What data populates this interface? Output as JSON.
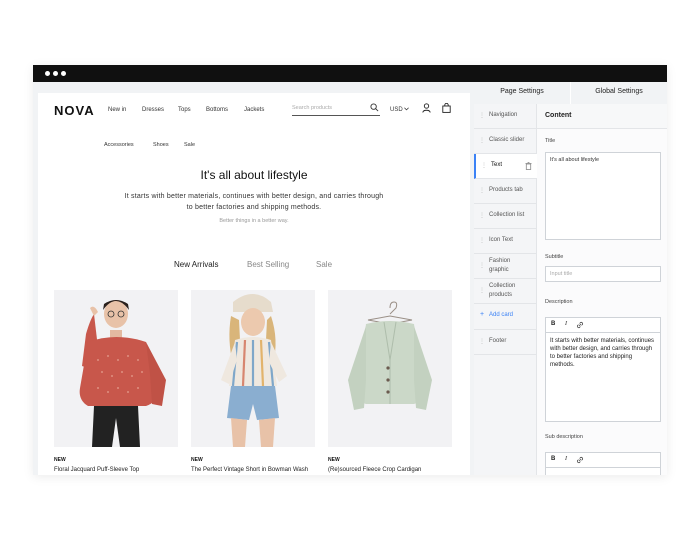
{
  "store": {
    "logo": "NOVA",
    "nav": [
      "New in",
      "Dresses",
      "Tops",
      "Bottoms",
      "Jackets"
    ],
    "search_placeholder": "Search products",
    "currency": "USD",
    "subnav": [
      "Accessories",
      "Shoes",
      "Sale"
    ],
    "hero": {
      "title": "It's all about lifestyle",
      "text": "It starts with better materials, continues with better design, and carries through to better factories and shipping methods.",
      "small": "Better things in a better way."
    },
    "tabs": [
      "New Arrivals",
      "Best Selling",
      "Sale"
    ],
    "products": [
      {
        "badge": "NEW",
        "name": "Floral Jacquard Puff-Sleeve Top"
      },
      {
        "badge": "NEW",
        "name": "The Perfect Vintage Short in Bowman Wash"
      },
      {
        "badge": "NEW",
        "name": "(Re)sourced Fleece Crop Cardigan"
      }
    ]
  },
  "panel": {
    "tabs": [
      "Page Settings",
      "Global Settings"
    ],
    "sections": [
      "Navigation",
      "Classic slider",
      "Text",
      "Products tab",
      "Collection list",
      "Icon Text",
      "Fashion graphic",
      "Collection products"
    ],
    "add_card": "Add card",
    "footer": "Footer",
    "content": {
      "heading": "Content",
      "title_label": "Title",
      "title_value": "It's all about lifestyle",
      "subtitle_label": "Subtitle",
      "subtitle_placeholder": "Input title",
      "description_label": "Description",
      "description_value": "It starts with better materials, continues with better design, and carries through to better factories and shipping methods.",
      "sub_description_label": "Sub description",
      "rte": {
        "bold": "B",
        "italic": "I"
      }
    }
  },
  "colors": {
    "accent": "#3b82f6",
    "titlebar": "#101010",
    "sweater_red": "#c8574b",
    "cardigan_sage": "#c9d6c6"
  },
  "icons": [
    "search-icon",
    "chevron-down-icon",
    "user-icon",
    "bag-icon",
    "drag-handle-icon",
    "trash-icon",
    "plus-icon",
    "link-icon"
  ]
}
